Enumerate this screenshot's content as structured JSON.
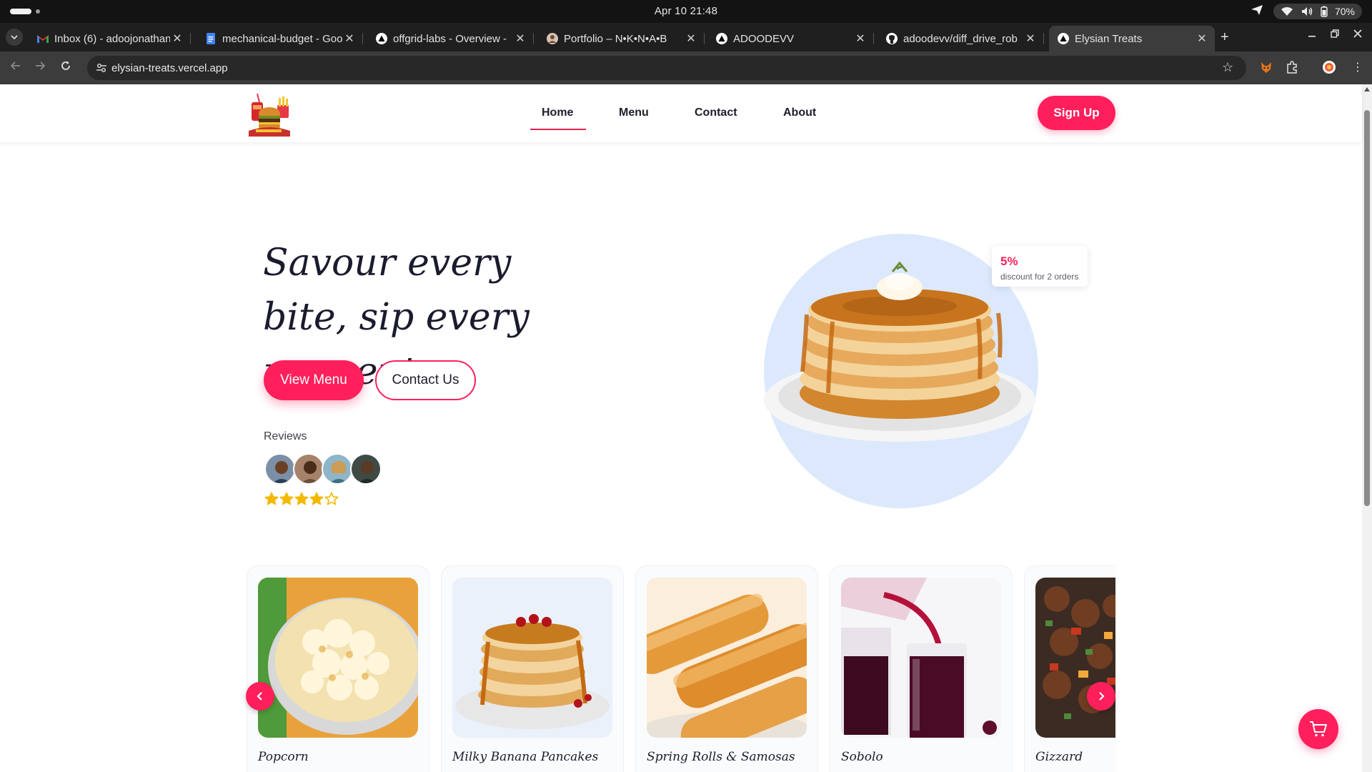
{
  "os": {
    "clock": "Apr 10  21:48",
    "battery": "70%"
  },
  "browser": {
    "tabs": [
      {
        "title": "Inbox (6) - adoojonathan",
        "icon": "gmail-icon"
      },
      {
        "title": "mechanical-budget - Goo",
        "icon": "docs-icon"
      },
      {
        "title": "offgrid-labs - Overview -",
        "icon": "vercel-icon"
      },
      {
        "title": "Portfolio – N•K•N•A•B",
        "icon": "avatar-icon"
      },
      {
        "title": "ADOODEVV",
        "icon": "vercel-icon"
      },
      {
        "title": "adoodevv/diff_drive_rob",
        "icon": "github-icon"
      },
      {
        "title": "Elysian Treats",
        "icon": "vercel-icon"
      }
    ],
    "url": "elysian-treats.vercel.app"
  },
  "header": {
    "nav": [
      {
        "label": "Home",
        "active": true
      },
      {
        "label": "Menu"
      },
      {
        "label": "Contact"
      },
      {
        "label": "About"
      }
    ],
    "signup_label": "Sign Up"
  },
  "hero": {
    "title_line1": "Savour every",
    "title_line2": "bite, sip every moment",
    "primary_button": "View Menu",
    "secondary_button": "Contact Us",
    "reviews_label": "Reviews",
    "rating": 4,
    "rating_max": 5,
    "discount": {
      "percent": "5%",
      "text": "discount for 2 orders"
    }
  },
  "products": [
    {
      "name": "Popcorn"
    },
    {
      "name": "Milky Banana Pancakes"
    },
    {
      "name": "Spring Rolls & Samosas"
    },
    {
      "name": "Sobolo"
    },
    {
      "name": "Gizzard"
    }
  ],
  "colors": {
    "accent": "#ff1f5b",
    "hero_circle": "#dce9fd",
    "star": "#f5b800"
  }
}
